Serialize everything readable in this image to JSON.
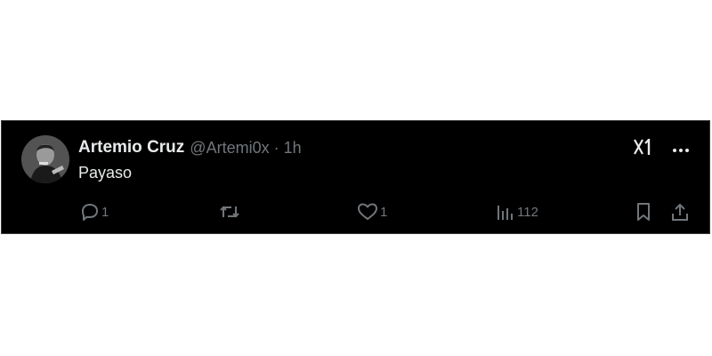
{
  "tweet": {
    "author_name": "Artemio Cruz",
    "handle": "@Artemi0x",
    "separator": "·",
    "time": "1h",
    "text": "Payaso",
    "actions": {
      "reply_count": "1",
      "like_count": "1",
      "views_count": "112"
    },
    "icons": [
      "grok-icon",
      "more-icon",
      "reply-icon",
      "retweet-icon",
      "like-icon",
      "views-icon",
      "bookmark-icon",
      "share-icon"
    ]
  },
  "colors": {
    "background": "#000000",
    "primary_text": "#e7e9ea",
    "secondary_text": "#71767b",
    "border": "#3a3a3a"
  }
}
